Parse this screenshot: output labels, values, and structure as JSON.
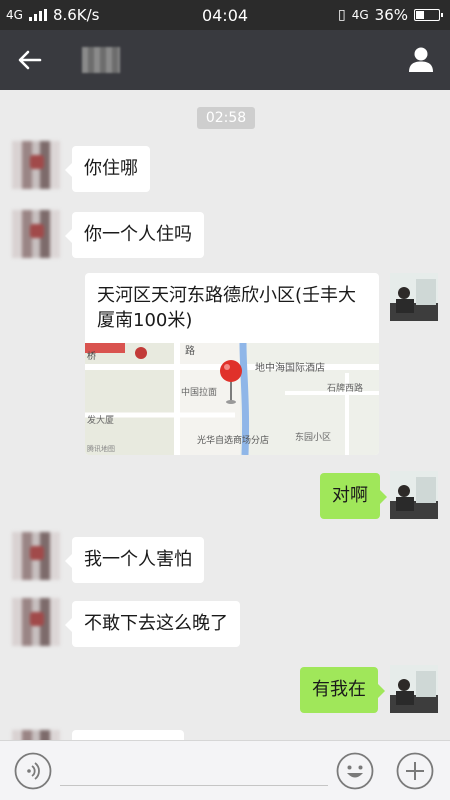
{
  "status_bar": {
    "network": "4G",
    "speed": "8.6K/s",
    "time": "04:04",
    "network_right": "4G",
    "battery": "36%",
    "battery_level": 0.36
  },
  "nav": {
    "back_icon": "arrow-left-icon",
    "profile_icon": "person-icon"
  },
  "chat": {
    "timestamp": "02:58",
    "messages": [
      {
        "from": "other",
        "text": "你住哪"
      },
      {
        "from": "other",
        "text": "你一个人住吗"
      },
      {
        "from": "me",
        "type": "location",
        "text": "天河区天河东路德欣小区(壬丰大厦南100米)"
      },
      {
        "from": "me",
        "text": "对啊"
      },
      {
        "from": "other",
        "text": "我一个人害怕"
      },
      {
        "from": "other",
        "text": "不敢下去这么晚了"
      },
      {
        "from": "me",
        "text": "有我在"
      }
    ]
  },
  "map": {
    "labels": [
      "路",
      "中国拉面",
      "地中海国际酒店",
      "石牌西路",
      "光华自选商场分店",
      "东园小区",
      "发大厦",
      "腾讯地图"
    ],
    "road": "桥"
  },
  "input_bar": {
    "voice_icon": "voice-icon",
    "emoji_icon": "emoji-icon",
    "plus_icon": "plus-icon"
  },
  "colors": {
    "accent_out_bubble": "#a0e75a",
    "nav_bg": "#393a3f",
    "status_bg": "#2b2b2b",
    "chat_bg": "#ebebeb",
    "pin": "#e0312a"
  }
}
